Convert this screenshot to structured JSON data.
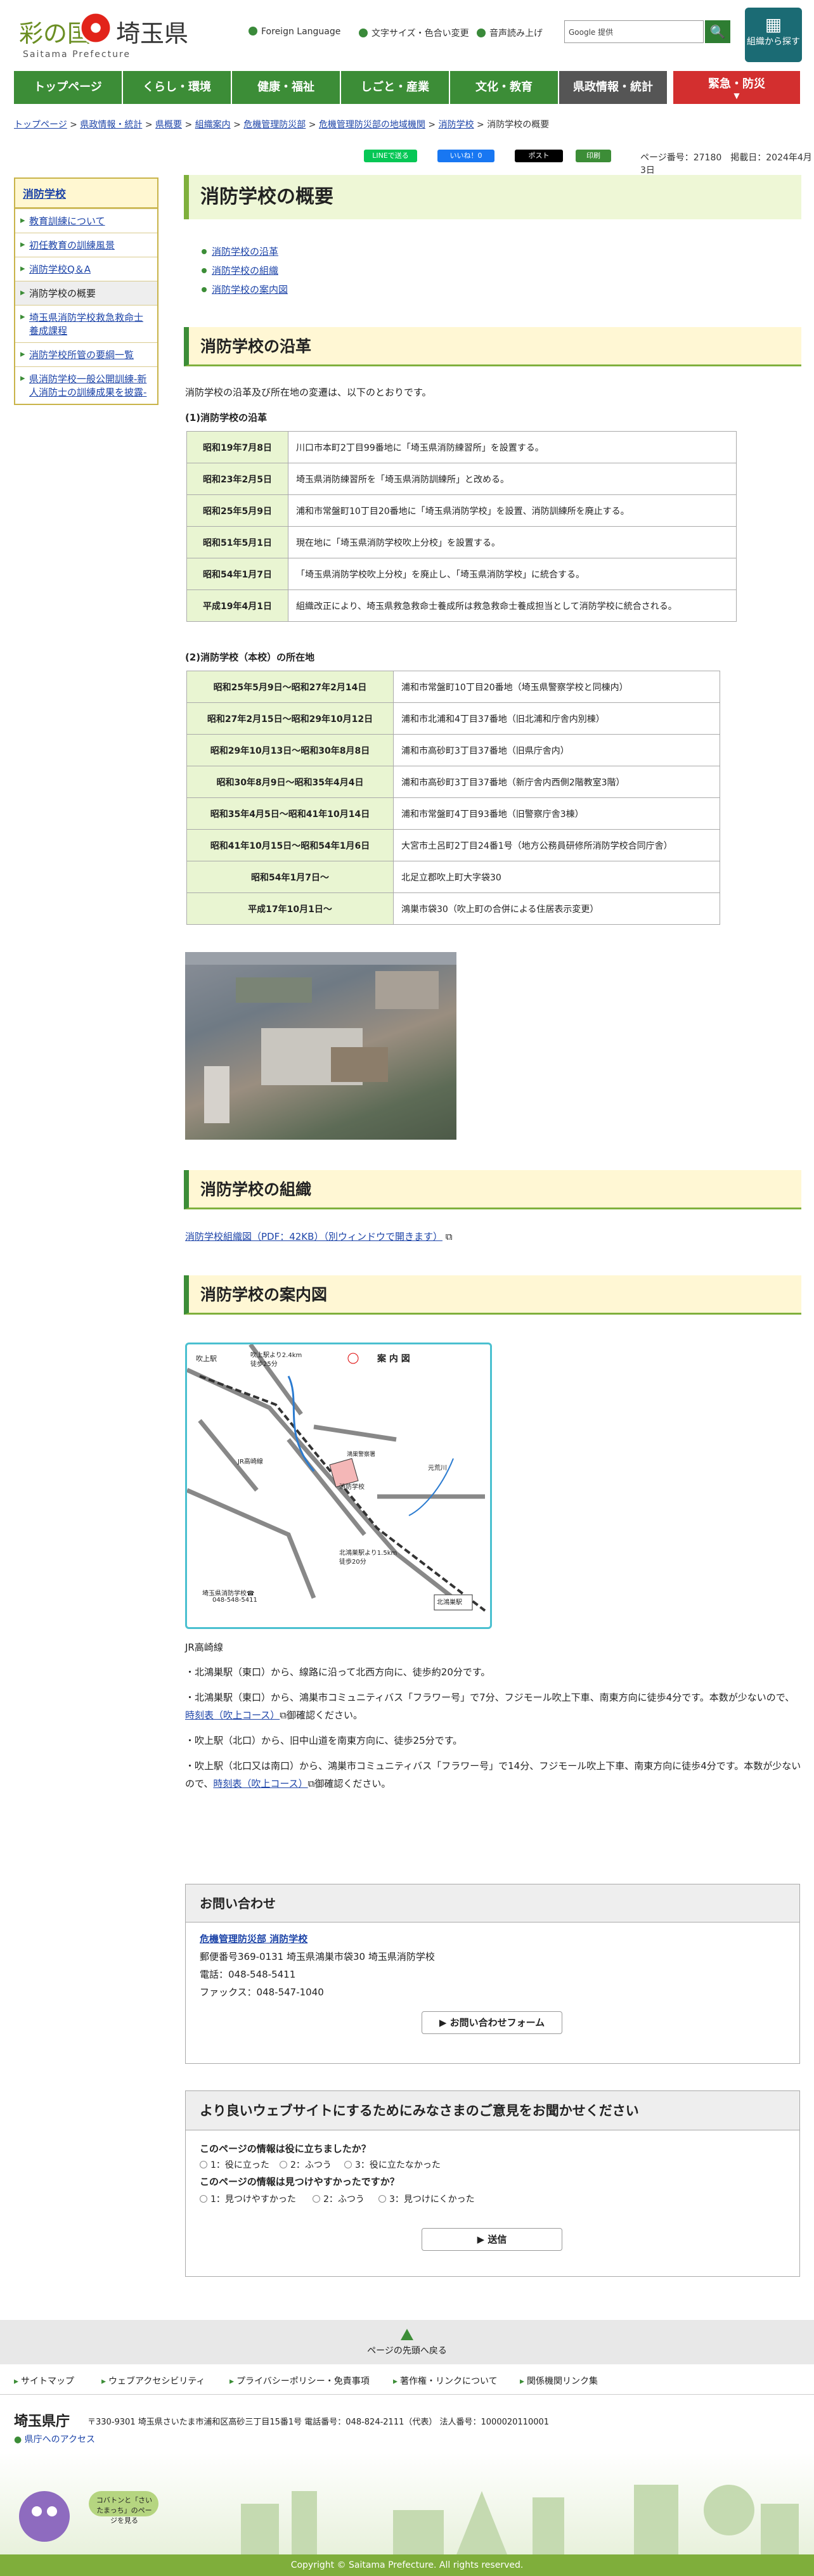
{
  "header": {
    "logo_main": "彩の国",
    "logo_pref": "埼玉県",
    "logo_sub": "Saitama Prefecture",
    "links": [
      "Foreign Language",
      "文字サイズ・色合い変更",
      "音声読み上げ"
    ],
    "search_placeholder": "Google 提供",
    "search_icon": "🔍",
    "org_button": "組織から探す"
  },
  "nav": {
    "items": [
      "トップページ",
      "くらし・環境",
      "健康・福祉",
      "しごと・産業",
      "文化・教育",
      "県政情報・統計"
    ],
    "emergency": "緊急・防災"
  },
  "breadcrumb": [
    "トップページ",
    "県政情報・統計",
    "県概要",
    "組織案内",
    "危機管理防災部",
    "危機管理防災部の地域機関",
    "消防学校",
    "消防学校の概要"
  ],
  "share": {
    "line": "LINEで送る",
    "fb": "いいね！0",
    "x": "ポスト",
    "print": "印刷",
    "page_info": "ページ番号：27180　掲載日：2024年4月3日"
  },
  "sidebar": {
    "head": "消防学校",
    "items": [
      "教育訓練について",
      "初任教育の訓練風景",
      "消防学校Q＆A",
      "消防学校の概要",
      "埼玉県消防学校救急救命士養成課程",
      "消防学校所管の要綱一覧",
      "県消防学校一般公開訓練-新人消防士の訓練成果を披露-"
    ]
  },
  "main": {
    "title": "消防学校の概要",
    "toc": [
      "消防学校の沿革",
      "消防学校の組織",
      "消防学校の案内図"
    ],
    "history": {
      "heading": "消防学校の沿革",
      "intro": "消防学校の沿革及び所在地の変遷は、以下のとおりです。",
      "sub1": "(1)消防学校の沿革",
      "rows1": [
        [
          "昭和19年7月8日",
          "川口市本町2丁目99番地に「埼玉県消防練習所」を設置する。"
        ],
        [
          "昭和23年2月5日",
          "埼玉県消防練習所を「埼玉県消防訓練所」と改める。"
        ],
        [
          "昭和25年5月9日",
          "浦和市常盤町10丁目20番地に「埼玉県消防学校」を設置、消防訓練所を廃止する。"
        ],
        [
          "昭和51年5月1日",
          "現在地に「埼玉県消防学校吹上分校」を設置する。"
        ],
        [
          "昭和54年1月7日",
          "「埼玉県消防学校吹上分校」を廃止し、「埼玉県消防学校」に統合する。"
        ],
        [
          "平成19年4月1日",
          "組織改正により、埼玉県救急救命士養成所は救急救命士養成担当として消防学校に統合される。"
        ]
      ],
      "sub2": "(2)消防学校（本校）の所在地",
      "rows2": [
        [
          "昭和25年5月9日～昭和27年2月14日",
          "浦和市常盤町10丁目20番地（埼玉県警察学校と同棟内）"
        ],
        [
          "昭和27年2月15日～昭和29年10月12日",
          "浦和市北浦和4丁目37番地（旧北浦和庁舎内別棟）"
        ],
        [
          "昭和29年10月13日～昭和30年8月8日",
          "浦和市高砂町3丁目37番地（旧県庁舎内）"
        ],
        [
          "昭和30年8月9日～昭和35年4月4日",
          "浦和市高砂町3丁目37番地（新庁舎内西側2階教室3階）"
        ],
        [
          "昭和35年4月5日～昭和41年10月14日",
          "浦和市常盤町4丁目93番地（旧警察庁舎3棟）"
        ],
        [
          "昭和41年10月15日～昭和54年1月6日",
          "大宮市土呂町2丁目24番1号（地方公務員研修所消防学校合同庁舎）"
        ],
        [
          "昭和54年1月7日～",
          "北足立郡吹上町大字袋30"
        ],
        [
          "平成17年10月1日～",
          "鴻巣市袋30（吹上町の合併による住居表示変更）"
        ]
      ]
    },
    "org": {
      "heading": "消防学校の組織",
      "link": "消防学校組織図（PDF：42KB）（別ウィンドウで開きます）"
    },
    "access": {
      "heading": "消防学校の案内図",
      "map_title": "案 内 図",
      "map_labels": [
        "吹上駅",
        "吹上駅より2.4km",
        "徒歩25分",
        "JR高崎線",
        "消防学校",
        "北鴻巣駅より1.5km",
        "徒歩20分",
        "北鴻巣駅",
        "元荒川",
        "埼玉県消防学校☎",
        "048-548-5411",
        "鴻巣警察署"
      ],
      "line": "JR高崎線",
      "items": [
        "・北鴻巣駅（東口）から、線路に沿って北西方向に、徒歩約20分です。",
        "・北鴻巣駅（東口）から、鴻巣市コミュニティバス「フラワー号」で7分、フジモール吹上下車、南東方向に徒歩4分です。本数が少ないので、",
        "・吹上駅（北口）から、旧中山道を南東方向に、徒歩25分です。",
        "・吹上駅（北口又は南口）から、鴻巣市コミュニティバス「フラワー号」で14分、フジモール吹上下車、南東方向に徒歩4分です。本数が少ないので、"
      ],
      "link1": "時刻表（吹上コース）",
      "link2": "時刻表（吹上コース）",
      "suffix": "御確認ください。"
    }
  },
  "contact": {
    "heading": "お問い合わせ",
    "dept": "危機管理防災部 消防学校",
    "addr": "郵便番号369-0131 埼玉県鴻巣市袋30 埼玉県消防学校",
    "tel": "電話：048-548-5411",
    "fax": "ファックス：048-547-1040",
    "form_btn": "お問い合わせフォーム"
  },
  "survey": {
    "heading": "より良いウェブサイトにするためにみなさまのご意見をお聞かせください",
    "q1": "このページの情報は役に立ちましたか？",
    "q1_opts": [
      "1：役に立った",
      "2：ふつう",
      "3：役に立たなかった"
    ],
    "q2": "このページの情報は見つけやすかったですか？",
    "q2_opts": [
      "1：見つけやすかった",
      "2：ふつう",
      "3：見つけにくかった"
    ],
    "submit": "送信"
  },
  "footer": {
    "totop": "ページの先頭へ戻る",
    "links": [
      "サイトマップ",
      "ウェブアクセシビリティ",
      "プライバシーポリシー・免責事項",
      "著作権・リンクについて",
      "関係機関リンク集"
    ],
    "name": "埼玉県庁",
    "addr": "〒330-9301 埼玉県さいたま市浦和区高砂三丁目15番1号 電話番号：048-824-2111（代表） 法人番号：1000020110001",
    "access": "県庁へのアクセス",
    "banner": "コバトンと「さいたまっち」のページを見る",
    "copyright": "Copyright © Saitama Prefecture. All rights reserved."
  }
}
